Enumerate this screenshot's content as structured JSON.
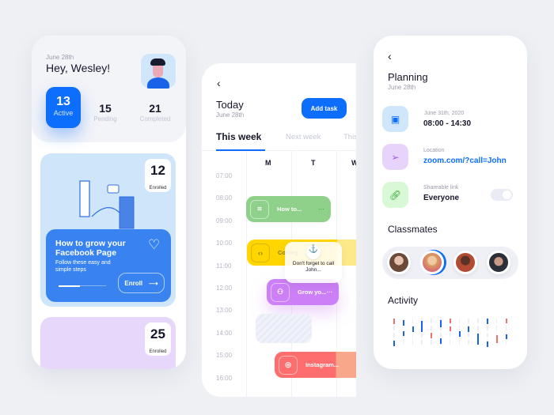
{
  "dashboard": {
    "date": "June 28th",
    "greeting": "Hey, Wesley!",
    "stats": [
      {
        "value": "13",
        "label": "Active"
      },
      {
        "value": "15",
        "label": "Pending"
      },
      {
        "value": "21",
        "label": "Completed"
      }
    ],
    "courses": [
      {
        "enrolled": "12",
        "enrolled_label": "Enrolled",
        "title": "How to grow your Facebook Page",
        "subtitle": "Follow these easy and simple steps",
        "button": "Enroll",
        "progress": 0.45,
        "color": "#cfe5fa"
      },
      {
        "enrolled": "25",
        "enrolled_label": "Enrolled",
        "color": "#e7d7fb"
      }
    ]
  },
  "schedule": {
    "title": "Today",
    "date": "June 28th",
    "add_task": "Add task",
    "tabs": [
      "This week",
      "Next week",
      "This"
    ],
    "days": [
      "M",
      "T",
      "W"
    ],
    "times": [
      "07:00",
      "08:00",
      "09:00",
      "10:00",
      "11:00",
      "12:00",
      "13:00",
      "14:00",
      "15:00",
      "16:00"
    ],
    "events": [
      {
        "label": "How to...",
        "color": "#8fd08a",
        "icon": "crop-icon"
      },
      {
        "label": "Coding",
        "color": "#ffd600",
        "icon": "code-icon"
      },
      {
        "label": "Grow yo...",
        "color": "#cc7ff6",
        "icon": "users-icon"
      },
      {
        "label": "Instagram...",
        "color": "#ff6e6e",
        "icon": "instagram-icon"
      }
    ],
    "tooltip": "Don't forget to call John..."
  },
  "planning": {
    "title": "Planning",
    "date": "June 28th",
    "details": [
      {
        "label": "June 31th, 2020",
        "value": "08:00 - 14:30",
        "icon": "calendar-icon"
      },
      {
        "label": "Location",
        "value": "zoom.com/?call=John",
        "icon": "send-icon"
      },
      {
        "label": "Shareable link",
        "value": "Everyone",
        "icon": "link-icon"
      }
    ],
    "classmates_title": "Classmates",
    "activity_title": "Activity",
    "accent": "#0d6efd"
  }
}
